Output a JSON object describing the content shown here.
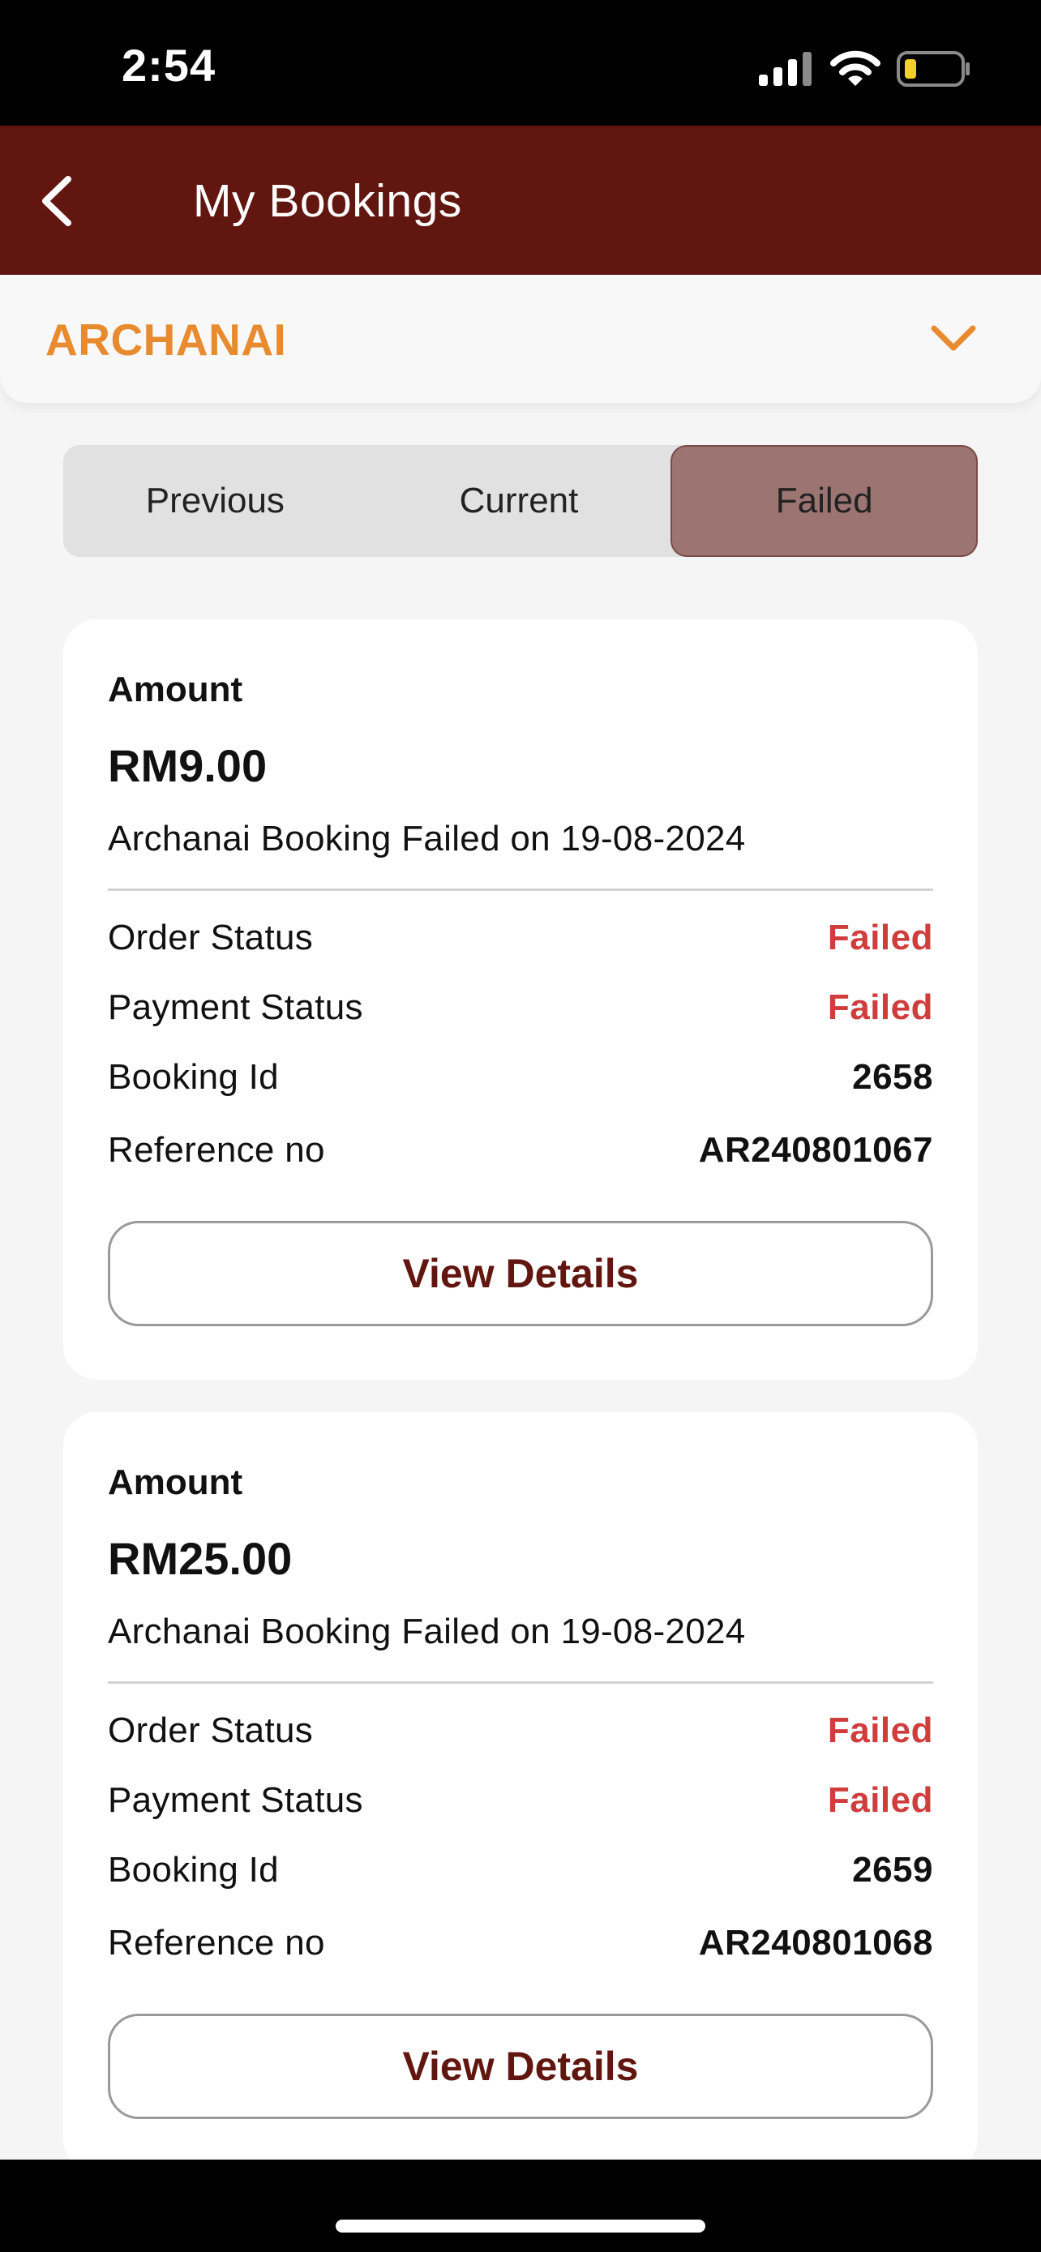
{
  "status_bar": {
    "time": "2:54",
    "icons": [
      "signal-icon",
      "wifi-icon",
      "battery-icon"
    ]
  },
  "header": {
    "title": "My Bookings",
    "back_icon": "chevron-left-icon",
    "background_color": "#621610"
  },
  "category": {
    "label": "ARCHANAI",
    "icon": "chevron-down-icon",
    "color": "#e88a2e"
  },
  "tabs": [
    {
      "label": "Previous",
      "active": false
    },
    {
      "label": "Current",
      "active": false
    },
    {
      "label": "Failed",
      "active": true
    }
  ],
  "bookings": [
    {
      "amount_label": "Amount",
      "amount": "RM9.00",
      "description": "Archanai Booking Failed on 19-08-2024",
      "rows": [
        {
          "label": "Order Status",
          "value": "Failed"
        },
        {
          "label": "Payment Status",
          "value": "Failed"
        },
        {
          "label": "Booking Id",
          "value": "2658"
        },
        {
          "label": "Reference no",
          "value": "AR240801067"
        }
      ],
      "button_label": "View Details"
    },
    {
      "amount_label": "Amount",
      "amount": "RM25.00",
      "description": "Archanai Booking Failed on 19-08-2024",
      "rows": [
        {
          "label": "Order Status",
          "value": "Failed"
        },
        {
          "label": "Payment Status",
          "value": "Failed"
        },
        {
          "label": "Booking Id",
          "value": "2659"
        },
        {
          "label": "Reference no",
          "value": "AR240801068"
        }
      ],
      "button_label": "View Details"
    }
  ],
  "colors": {
    "failed": "#cf3d3d",
    "active_tab": "#9c7472",
    "button_text": "#621610"
  }
}
